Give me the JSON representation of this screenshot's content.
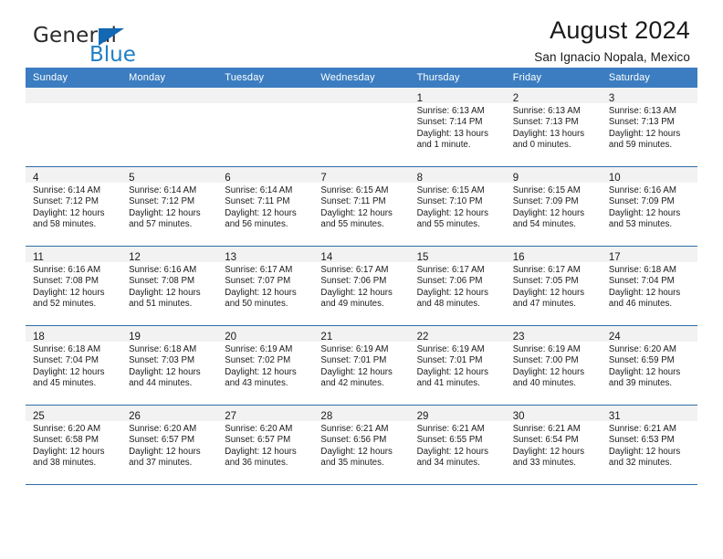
{
  "brand": {
    "name_top": "General",
    "name_bottom": "Blue",
    "triangle_color": "#1268b3",
    "blue_text_color": "#1f7fc4"
  },
  "header": {
    "title": "August 2024",
    "subtitle": "San Ignacio Nopala, Mexico"
  },
  "theme": {
    "header_row_bg": "#3b7dc0",
    "grid_line": "#2e6da8",
    "daynum_band_bg": "#f2f2f2",
    "text": "#1a1a1a"
  },
  "weekday_headers": [
    "Sunday",
    "Monday",
    "Tuesday",
    "Wednesday",
    "Thursday",
    "Friday",
    "Saturday"
  ],
  "weeks": [
    [
      {
        "day": "",
        "lines": []
      },
      {
        "day": "",
        "lines": []
      },
      {
        "day": "",
        "lines": []
      },
      {
        "day": "",
        "lines": []
      },
      {
        "day": "1",
        "lines": [
          "Sunrise: 6:13 AM",
          "Sunset: 7:14 PM",
          "Daylight: 13 hours",
          "and 1 minute."
        ]
      },
      {
        "day": "2",
        "lines": [
          "Sunrise: 6:13 AM",
          "Sunset: 7:13 PM",
          "Daylight: 13 hours",
          "and 0 minutes."
        ]
      },
      {
        "day": "3",
        "lines": [
          "Sunrise: 6:13 AM",
          "Sunset: 7:13 PM",
          "Daylight: 12 hours",
          "and 59 minutes."
        ]
      }
    ],
    [
      {
        "day": "4",
        "lines": [
          "Sunrise: 6:14 AM",
          "Sunset: 7:12 PM",
          "Daylight: 12 hours",
          "and 58 minutes."
        ]
      },
      {
        "day": "5",
        "lines": [
          "Sunrise: 6:14 AM",
          "Sunset: 7:12 PM",
          "Daylight: 12 hours",
          "and 57 minutes."
        ]
      },
      {
        "day": "6",
        "lines": [
          "Sunrise: 6:14 AM",
          "Sunset: 7:11 PM",
          "Daylight: 12 hours",
          "and 56 minutes."
        ]
      },
      {
        "day": "7",
        "lines": [
          "Sunrise: 6:15 AM",
          "Sunset: 7:11 PM",
          "Daylight: 12 hours",
          "and 55 minutes."
        ]
      },
      {
        "day": "8",
        "lines": [
          "Sunrise: 6:15 AM",
          "Sunset: 7:10 PM",
          "Daylight: 12 hours",
          "and 55 minutes."
        ]
      },
      {
        "day": "9",
        "lines": [
          "Sunrise: 6:15 AM",
          "Sunset: 7:09 PM",
          "Daylight: 12 hours",
          "and 54 minutes."
        ]
      },
      {
        "day": "10",
        "lines": [
          "Sunrise: 6:16 AM",
          "Sunset: 7:09 PM",
          "Daylight: 12 hours",
          "and 53 minutes."
        ]
      }
    ],
    [
      {
        "day": "11",
        "lines": [
          "Sunrise: 6:16 AM",
          "Sunset: 7:08 PM",
          "Daylight: 12 hours",
          "and 52 minutes."
        ]
      },
      {
        "day": "12",
        "lines": [
          "Sunrise: 6:16 AM",
          "Sunset: 7:08 PM",
          "Daylight: 12 hours",
          "and 51 minutes."
        ]
      },
      {
        "day": "13",
        "lines": [
          "Sunrise: 6:17 AM",
          "Sunset: 7:07 PM",
          "Daylight: 12 hours",
          "and 50 minutes."
        ]
      },
      {
        "day": "14",
        "lines": [
          "Sunrise: 6:17 AM",
          "Sunset: 7:06 PM",
          "Daylight: 12 hours",
          "and 49 minutes."
        ]
      },
      {
        "day": "15",
        "lines": [
          "Sunrise: 6:17 AM",
          "Sunset: 7:06 PM",
          "Daylight: 12 hours",
          "and 48 minutes."
        ]
      },
      {
        "day": "16",
        "lines": [
          "Sunrise: 6:17 AM",
          "Sunset: 7:05 PM",
          "Daylight: 12 hours",
          "and 47 minutes."
        ]
      },
      {
        "day": "17",
        "lines": [
          "Sunrise: 6:18 AM",
          "Sunset: 7:04 PM",
          "Daylight: 12 hours",
          "and 46 minutes."
        ]
      }
    ],
    [
      {
        "day": "18",
        "lines": [
          "Sunrise: 6:18 AM",
          "Sunset: 7:04 PM",
          "Daylight: 12 hours",
          "and 45 minutes."
        ]
      },
      {
        "day": "19",
        "lines": [
          "Sunrise: 6:18 AM",
          "Sunset: 7:03 PM",
          "Daylight: 12 hours",
          "and 44 minutes."
        ]
      },
      {
        "day": "20",
        "lines": [
          "Sunrise: 6:19 AM",
          "Sunset: 7:02 PM",
          "Daylight: 12 hours",
          "and 43 minutes."
        ]
      },
      {
        "day": "21",
        "lines": [
          "Sunrise: 6:19 AM",
          "Sunset: 7:01 PM",
          "Daylight: 12 hours",
          "and 42 minutes."
        ]
      },
      {
        "day": "22",
        "lines": [
          "Sunrise: 6:19 AM",
          "Sunset: 7:01 PM",
          "Daylight: 12 hours",
          "and 41 minutes."
        ]
      },
      {
        "day": "23",
        "lines": [
          "Sunrise: 6:19 AM",
          "Sunset: 7:00 PM",
          "Daylight: 12 hours",
          "and 40 minutes."
        ]
      },
      {
        "day": "24",
        "lines": [
          "Sunrise: 6:20 AM",
          "Sunset: 6:59 PM",
          "Daylight: 12 hours",
          "and 39 minutes."
        ]
      }
    ],
    [
      {
        "day": "25",
        "lines": [
          "Sunrise: 6:20 AM",
          "Sunset: 6:58 PM",
          "Daylight: 12 hours",
          "and 38 minutes."
        ]
      },
      {
        "day": "26",
        "lines": [
          "Sunrise: 6:20 AM",
          "Sunset: 6:57 PM",
          "Daylight: 12 hours",
          "and 37 minutes."
        ]
      },
      {
        "day": "27",
        "lines": [
          "Sunrise: 6:20 AM",
          "Sunset: 6:57 PM",
          "Daylight: 12 hours",
          "and 36 minutes."
        ]
      },
      {
        "day": "28",
        "lines": [
          "Sunrise: 6:21 AM",
          "Sunset: 6:56 PM",
          "Daylight: 12 hours",
          "and 35 minutes."
        ]
      },
      {
        "day": "29",
        "lines": [
          "Sunrise: 6:21 AM",
          "Sunset: 6:55 PM",
          "Daylight: 12 hours",
          "and 34 minutes."
        ]
      },
      {
        "day": "30",
        "lines": [
          "Sunrise: 6:21 AM",
          "Sunset: 6:54 PM",
          "Daylight: 12 hours",
          "and 33 minutes."
        ]
      },
      {
        "day": "31",
        "lines": [
          "Sunrise: 6:21 AM",
          "Sunset: 6:53 PM",
          "Daylight: 12 hours",
          "and 32 minutes."
        ]
      }
    ]
  ]
}
